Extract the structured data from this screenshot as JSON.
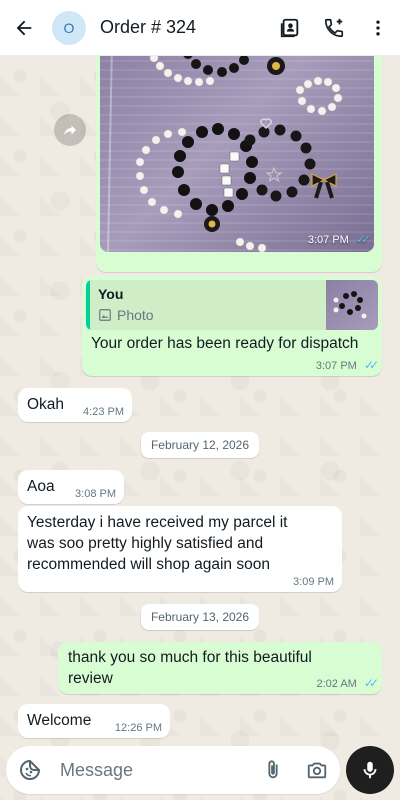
{
  "header": {
    "avatar_letter": "O",
    "title": "Order # 324",
    "icons": [
      "back-arrow-icon",
      "contact-card-icon",
      "add-call-icon",
      "more-vert-icon"
    ]
  },
  "messages": {
    "photo_msg": {
      "time": "3:07 PM",
      "status": "read"
    },
    "reply_msg": {
      "quote_author": "You",
      "quote_type": "Photo",
      "text": "Your order has been ready for dispatch",
      "time": "3:07 PM",
      "status": "read"
    },
    "okah": {
      "text": "Okah",
      "time": "4:23 PM"
    },
    "aoa": {
      "text": "Aoa",
      "time": "3:08 PM"
    },
    "review": {
      "text": "Yesterday i have received my parcel it was soo pretty highly satisfied and recommended will shop again soon",
      "time": "3:09 PM"
    },
    "thanks": {
      "text": "thank you so much for this beautiful review",
      "time": "2:02 AM",
      "status": "read"
    },
    "welcome": {
      "text": "Welcome",
      "time": "12:26 PM"
    }
  },
  "dates": {
    "d1": "February 12, 2026",
    "d2": "February 13, 2026"
  },
  "composer": {
    "placeholder": "Message",
    "icons": [
      "sticker-icon",
      "attach-icon",
      "camera-icon",
      "mic-icon"
    ]
  },
  "colors": {
    "outgoing_bubble": "#d9fdd3",
    "incoming_bubble": "#ffffff",
    "chat_background": "#efeae2",
    "read_ticks": "#53bdeb",
    "quote_bar": "#06cf9c"
  }
}
